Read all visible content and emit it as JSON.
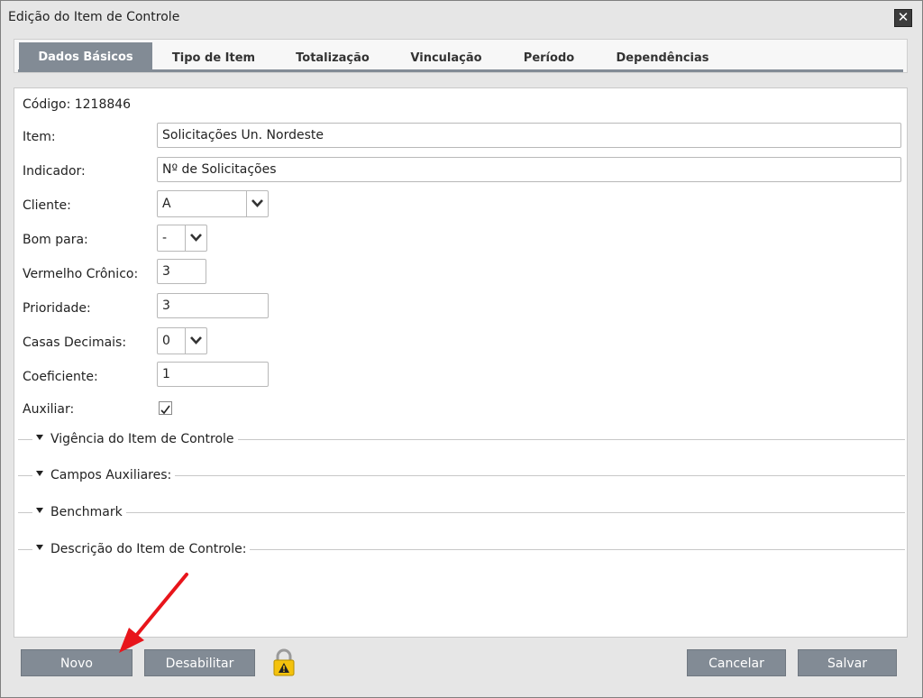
{
  "dialog": {
    "title": "Edição do Item de Controle",
    "close_label": "✕"
  },
  "tabs": [
    {
      "label": "Dados Básicos",
      "active": true
    },
    {
      "label": "Tipo de Item",
      "active": false
    },
    {
      "label": "Totalização",
      "active": false
    },
    {
      "label": "Vinculação",
      "active": false
    },
    {
      "label": "Período",
      "active": false
    },
    {
      "label": "Dependências",
      "active": false
    }
  ],
  "form": {
    "codigo": "Código: 1218846",
    "item": {
      "label": "Item:",
      "value": "Solicitações Un. Nordeste"
    },
    "indicador": {
      "label": "Indicador:",
      "value": "Nº de Solicitações"
    },
    "cliente": {
      "label": "Cliente:",
      "value": "A"
    },
    "bom_para": {
      "label": "Bom para:",
      "value": "-"
    },
    "vermelho_cronico": {
      "label": "Vermelho Crônico:",
      "value": "3"
    },
    "prioridade": {
      "label": "Prioridade:",
      "value": "3"
    },
    "casas_decimais": {
      "label": "Casas Decimais:",
      "value": "0"
    },
    "coeficiente": {
      "label": "Coeficiente:",
      "value": "1"
    },
    "auxiliar": {
      "label": "Auxiliar:",
      "checked": true
    }
  },
  "sections": [
    "Vigência do Item de Controle",
    "Campos Auxiliares:",
    "Benchmark",
    "Descrição do Item de Controle:"
  ],
  "buttons": {
    "novo": "Novo",
    "desabilitar": "Desabilitar",
    "cancelar": "Cancelar",
    "salvar": "Salvar"
  },
  "icons": {
    "lock": "lock-warning-icon",
    "close": "close-icon",
    "annotation": "red-arrow-annotation"
  },
  "colors": {
    "tab_active": "#828b95",
    "button": "#828b95",
    "annotation_arrow": "#e8151b",
    "lock_yellow": "#f4c20d"
  }
}
